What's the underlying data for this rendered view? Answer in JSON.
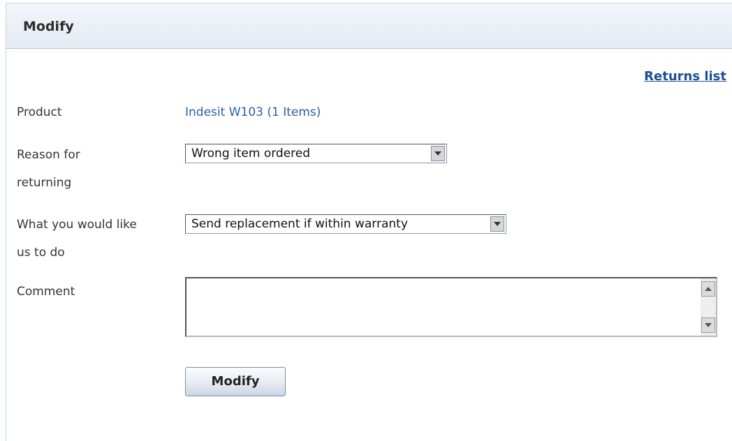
{
  "header": {
    "title": "Modify"
  },
  "links": {
    "returns_list": "Returns list"
  },
  "form": {
    "product": {
      "label": "Product",
      "value": "Indesit W103 (1 Items)"
    },
    "reason": {
      "label_line1": "Reason for",
      "label_line2": "returning",
      "selected": "Wrong item ordered"
    },
    "action": {
      "label_line1": "What you would like",
      "label_line2": "us to do",
      "selected": "Send replacement if within warranty"
    },
    "comment": {
      "label": "Comment",
      "value": ""
    },
    "submit_label": "Modify"
  },
  "colors": {
    "link": "#2a5fa8",
    "header_bg": "#e4ebf2"
  }
}
